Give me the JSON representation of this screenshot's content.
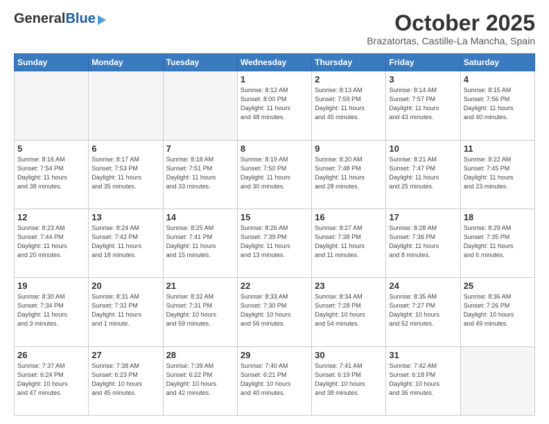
{
  "logo": {
    "general": "General",
    "blue": "Blue"
  },
  "header": {
    "month": "October 2025",
    "location": "Brazatortas, Castille-La Mancha, Spain"
  },
  "weekdays": [
    "Sunday",
    "Monday",
    "Tuesday",
    "Wednesday",
    "Thursday",
    "Friday",
    "Saturday"
  ],
  "weeks": [
    [
      {
        "day": "",
        "info": ""
      },
      {
        "day": "",
        "info": ""
      },
      {
        "day": "",
        "info": ""
      },
      {
        "day": "1",
        "info": "Sunrise: 8:12 AM\nSunset: 8:00 PM\nDaylight: 11 hours\nand 48 minutes."
      },
      {
        "day": "2",
        "info": "Sunrise: 8:13 AM\nSunset: 7:59 PM\nDaylight: 11 hours\nand 45 minutes."
      },
      {
        "day": "3",
        "info": "Sunrise: 8:14 AM\nSunset: 7:57 PM\nDaylight: 11 hours\nand 43 minutes."
      },
      {
        "day": "4",
        "info": "Sunrise: 8:15 AM\nSunset: 7:56 PM\nDaylight: 11 hours\nand 40 minutes."
      }
    ],
    [
      {
        "day": "5",
        "info": "Sunrise: 8:16 AM\nSunset: 7:54 PM\nDaylight: 11 hours\nand 38 minutes."
      },
      {
        "day": "6",
        "info": "Sunrise: 8:17 AM\nSunset: 7:53 PM\nDaylight: 11 hours\nand 35 minutes."
      },
      {
        "day": "7",
        "info": "Sunrise: 8:18 AM\nSunset: 7:51 PM\nDaylight: 11 hours\nand 33 minutes."
      },
      {
        "day": "8",
        "info": "Sunrise: 8:19 AM\nSunset: 7:50 PM\nDaylight: 11 hours\nand 30 minutes."
      },
      {
        "day": "9",
        "info": "Sunrise: 8:20 AM\nSunset: 7:48 PM\nDaylight: 11 hours\nand 28 minutes."
      },
      {
        "day": "10",
        "info": "Sunrise: 8:21 AM\nSunset: 7:47 PM\nDaylight: 11 hours\nand 25 minutes."
      },
      {
        "day": "11",
        "info": "Sunrise: 8:22 AM\nSunset: 7:45 PM\nDaylight: 11 hours\nand 23 minutes."
      }
    ],
    [
      {
        "day": "12",
        "info": "Sunrise: 8:23 AM\nSunset: 7:44 PM\nDaylight: 11 hours\nand 20 minutes."
      },
      {
        "day": "13",
        "info": "Sunrise: 8:24 AM\nSunset: 7:42 PM\nDaylight: 11 hours\nand 18 minutes."
      },
      {
        "day": "14",
        "info": "Sunrise: 8:25 AM\nSunset: 7:41 PM\nDaylight: 11 hours\nand 15 minutes."
      },
      {
        "day": "15",
        "info": "Sunrise: 8:26 AM\nSunset: 7:39 PM\nDaylight: 11 hours\nand 13 minutes."
      },
      {
        "day": "16",
        "info": "Sunrise: 8:27 AM\nSunset: 7:38 PM\nDaylight: 11 hours\nand 11 minutes."
      },
      {
        "day": "17",
        "info": "Sunrise: 8:28 AM\nSunset: 7:36 PM\nDaylight: 11 hours\nand 8 minutes."
      },
      {
        "day": "18",
        "info": "Sunrise: 8:29 AM\nSunset: 7:35 PM\nDaylight: 11 hours\nand 6 minutes."
      }
    ],
    [
      {
        "day": "19",
        "info": "Sunrise: 8:30 AM\nSunset: 7:34 PM\nDaylight: 11 hours\nand 3 minutes."
      },
      {
        "day": "20",
        "info": "Sunrise: 8:31 AM\nSunset: 7:32 PM\nDaylight: 11 hours\nand 1 minute."
      },
      {
        "day": "21",
        "info": "Sunrise: 8:32 AM\nSunset: 7:31 PM\nDaylight: 10 hours\nand 59 minutes."
      },
      {
        "day": "22",
        "info": "Sunrise: 8:33 AM\nSunset: 7:30 PM\nDaylight: 10 hours\nand 56 minutes."
      },
      {
        "day": "23",
        "info": "Sunrise: 8:34 AM\nSunset: 7:28 PM\nDaylight: 10 hours\nand 54 minutes."
      },
      {
        "day": "24",
        "info": "Sunrise: 8:35 AM\nSunset: 7:27 PM\nDaylight: 10 hours\nand 52 minutes."
      },
      {
        "day": "25",
        "info": "Sunrise: 8:36 AM\nSunset: 7:26 PM\nDaylight: 10 hours\nand 49 minutes."
      }
    ],
    [
      {
        "day": "26",
        "info": "Sunrise: 7:37 AM\nSunset: 6:24 PM\nDaylight: 10 hours\nand 47 minutes."
      },
      {
        "day": "27",
        "info": "Sunrise: 7:38 AM\nSunset: 6:23 PM\nDaylight: 10 hours\nand 45 minutes."
      },
      {
        "day": "28",
        "info": "Sunrise: 7:39 AM\nSunset: 6:22 PM\nDaylight: 10 hours\nand 42 minutes."
      },
      {
        "day": "29",
        "info": "Sunrise: 7:40 AM\nSunset: 6:21 PM\nDaylight: 10 hours\nand 40 minutes."
      },
      {
        "day": "30",
        "info": "Sunrise: 7:41 AM\nSunset: 6:19 PM\nDaylight: 10 hours\nand 38 minutes."
      },
      {
        "day": "31",
        "info": "Sunrise: 7:42 AM\nSunset: 6:18 PM\nDaylight: 10 hours\nand 36 minutes."
      },
      {
        "day": "",
        "info": ""
      }
    ]
  ]
}
